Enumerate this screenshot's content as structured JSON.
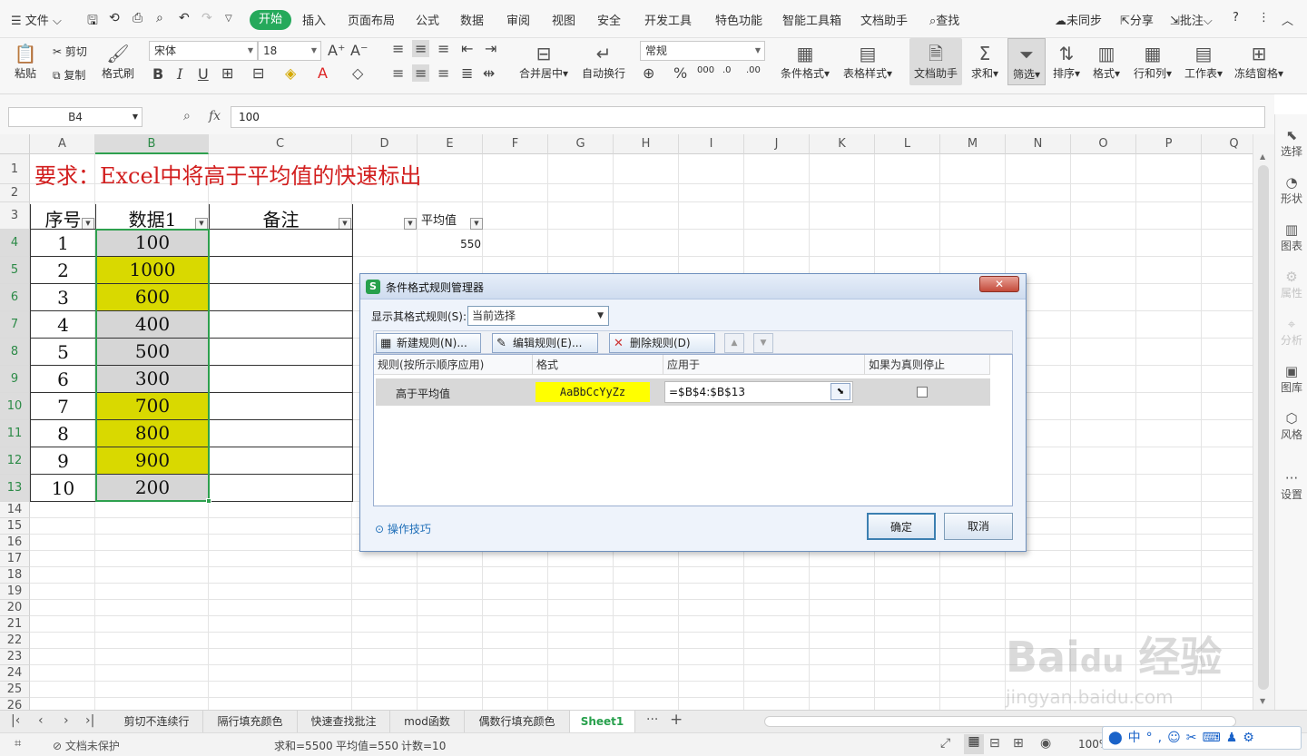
{
  "menubar": {
    "file": "文件",
    "active_tab": "开始",
    "tabs": [
      "插入",
      "页面布局",
      "公式",
      "数据",
      "审阅",
      "视图",
      "安全",
      "开发工具",
      "特色功能",
      "智能工具箱",
      "文档助手"
    ],
    "search": "查找",
    "sync": "未同步",
    "share": "分享",
    "comment": "批注"
  },
  "ribbon": {
    "paste": "粘贴",
    "cut": "剪切",
    "copy": "复制",
    "format_painter": "格式刷",
    "font_name": "宋体",
    "font_size": "18",
    "number_format": "常规",
    "merge_center": "合并居中",
    "wrap_text": "自动换行",
    "conditional_format": "条件格式",
    "table_style": "表格样式",
    "doc_assistant": "文档助手",
    "sum": "求和",
    "filter": "筛选",
    "sort": "排序",
    "format": "格式",
    "row_col": "行和列",
    "worksheet": "工作表",
    "freeze": "冻结窗格"
  },
  "formula_bar": {
    "cell_ref": "B4",
    "fx": "fx",
    "value": "100"
  },
  "columns": [
    "A",
    "B",
    "C",
    "D",
    "E",
    "F",
    "G",
    "H",
    "I",
    "J",
    "K",
    "L",
    "M",
    "N",
    "O",
    "P",
    "Q"
  ],
  "rows": [
    "1",
    "2",
    "3",
    "4",
    "5",
    "6",
    "7",
    "8",
    "9",
    "10",
    "11",
    "12",
    "13",
    "14",
    "15",
    "16",
    "17",
    "18",
    "19",
    "20",
    "21",
    "22",
    "23",
    "24",
    "25",
    "26"
  ],
  "sheet": {
    "title": "要求：Excel中将高于平均值的快速标出",
    "headers": [
      "序号",
      "数据1",
      "备注"
    ],
    "avg_label": "平均值",
    "avg_value": "550",
    "data": [
      {
        "no": "1",
        "value": "100",
        "highlight": false
      },
      {
        "no": "2",
        "value": "1000",
        "highlight": true
      },
      {
        "no": "3",
        "value": "600",
        "highlight": true
      },
      {
        "no": "4",
        "value": "400",
        "highlight": false
      },
      {
        "no": "5",
        "value": "500",
        "highlight": false
      },
      {
        "no": "6",
        "value": "300",
        "highlight": false
      },
      {
        "no": "7",
        "value": "700",
        "highlight": true
      },
      {
        "no": "8",
        "value": "800",
        "highlight": true
      },
      {
        "no": "9",
        "value": "900",
        "highlight": true
      },
      {
        "no": "10",
        "value": "200",
        "highlight": false
      }
    ],
    "highlight_color": "#d9d900",
    "normal_color": "#d6d6d6"
  },
  "right_panel": [
    "选择",
    "形状",
    "图表",
    "属性",
    "分析",
    "图库",
    "风格",
    "设置"
  ],
  "sheet_tabs": [
    "剪切不连续行",
    "隔行填充颜色",
    "快速查找批注",
    "mod函数",
    "偶数行填充颜色",
    "Sheet1"
  ],
  "status": {
    "protect": "文档未保护",
    "sum": "求和=5500",
    "avg": "平均值=550",
    "count": "计数=10",
    "zoom": "100%"
  },
  "dialog": {
    "title": "条件格式规则管理器",
    "show_rules_label": "显示其格式规则(S):",
    "show_rules_value": "当前选择",
    "new_rule": "新建规则(N)...",
    "edit_rule": "编辑规则(E)...",
    "delete_rule": "删除规则(D)",
    "col_rule": "规则(按所示顺序应用)",
    "col_format": "格式",
    "col_apply": "应用于",
    "col_stop": "如果为真则停止",
    "rule_name": "高于平均值",
    "rule_preview": "AaBbCcYyZz",
    "rule_range": "=$B$4:$B$13",
    "tips": "操作技巧",
    "ok": "确定",
    "cancel": "取消"
  },
  "colors": {
    "accent": "#25a95b",
    "preview_fill": "#ffff00",
    "title_red": "#d21e1e"
  }
}
